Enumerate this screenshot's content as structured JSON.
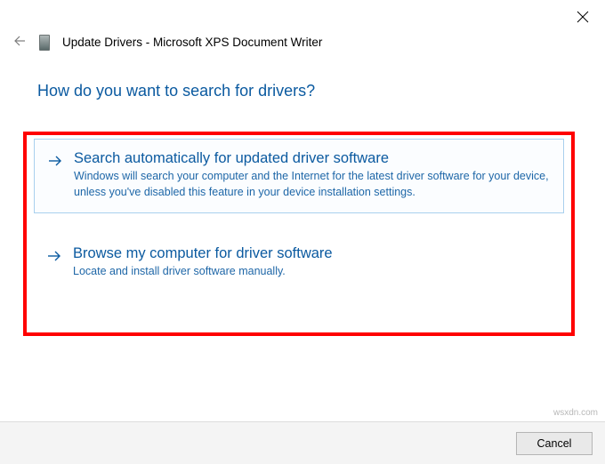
{
  "window": {
    "title": "Update Drivers - Microsoft XPS Document Writer"
  },
  "heading": "How do you want to search for drivers?",
  "options": {
    "auto": {
      "title": "Search automatically for updated driver software",
      "description": "Windows will search your computer and the Internet for the latest driver software for your device, unless you've disabled this feature in your device installation settings."
    },
    "browse": {
      "title": "Browse my computer for driver software",
      "description": "Locate and install driver software manually."
    }
  },
  "footer": {
    "cancel_label": "Cancel"
  },
  "watermark": "wsxdn.com"
}
